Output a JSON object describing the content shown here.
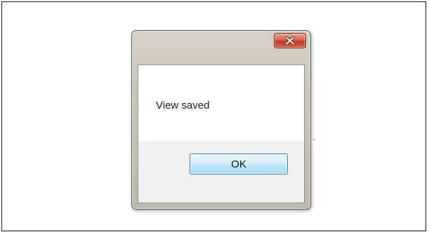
{
  "dialog": {
    "message": "View saved",
    "ok_label": "OK",
    "close_icon": "close-icon"
  }
}
